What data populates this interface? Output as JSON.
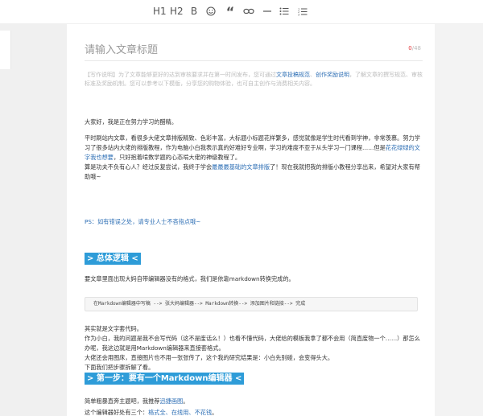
{
  "toolbar": {
    "h1": "H1",
    "h2": "H2",
    "bold": "B",
    "quote": "“"
  },
  "editor": {
    "title_placeholder": "请输入文章标题",
    "title_count_current": "0",
    "title_count_max": "/48",
    "tip": {
      "label": "【写作说明】",
      "text1": "为了文章能够更好的达到审核要求并在第一时间发布，您可通过",
      "link1": "文章投稿规范",
      "sep": "、",
      "link2": "创作奖励说明",
      "text2": "，了解文章的撰写规范、审核标准及奖励机制。您可以参考以下模版，分享您的购物体验，也可自主创作与消费相关内容。"
    },
    "paragraphs": {
      "p1": "大家好，我是正在努力学习的醋精。",
      "p2": "平时刷站内文章，看很多大佬文章排版精致、色彩丰富，大标题小标题花样繁多，感觉就像是学生时代看到学神，非常羡慕。努力学习了很多站内大佬的排版教程，作为电脑小白我表示真的好难好专业啊，学习的难度不亚于从头学习一门课程……但是",
      "p2_link": "花花绿绿的文字我也想要",
      "p2_end": "，只好抱着啃数学题的心态啃大佬的神级教程了。",
      "p3": "算是功夫不负有心人？经过反复尝试，我终于学会",
      "p3_link": "最最最基础的文章排版",
      "p3_end": "了！现在我就把我的排版小教程分享出来，希望对大家有帮助哦~"
    },
    "ps": "PS：如有错误之处，请专业人士不吝指点哦~",
    "section1": "> 总体逻辑 <",
    "section1_text": "要文章里面出现大妈自带编辑器没有的格式，我们是依靠markdown转换完成的。",
    "code": "在Markdown编辑器中写稿 --> 张大妈编辑器--> Markdown转换--> 添加图片和链接--> 完成",
    "body2": {
      "l1": "其实就是文字套代码。",
      "l2": "作为小白，我的问题是我不会写代码（这不是废话么！）也看不懂代码，大佬给的模板我拿了都不会用（简直废物一个……）那怎么办呢，我这边就是用Markdown编辑器来直接套格式。",
      "l3": "大佬还会用图床，直接图片也不用一张张传了，这个我的研究结果是：小白先别碰，会变得头大。",
      "l4": "下面我们把步骤拆解了看。"
    },
    "section2": "> 第一步：要有一个Markdown编辑器 <",
    "body3": {
      "l1": "简单粗暴直奔主题吧，我推荐",
      "l1_link": "迅捷画图",
      "l1_end": "。",
      "l2": "这个编辑器好处有三个：",
      "l2_link": "格式全、在线用、不花钱",
      "l2_end": "。"
    }
  },
  "colors": {
    "accent_blue": "#2e9cd8",
    "link_blue": "#2e6fb5",
    "count_red": "#e4393c"
  }
}
